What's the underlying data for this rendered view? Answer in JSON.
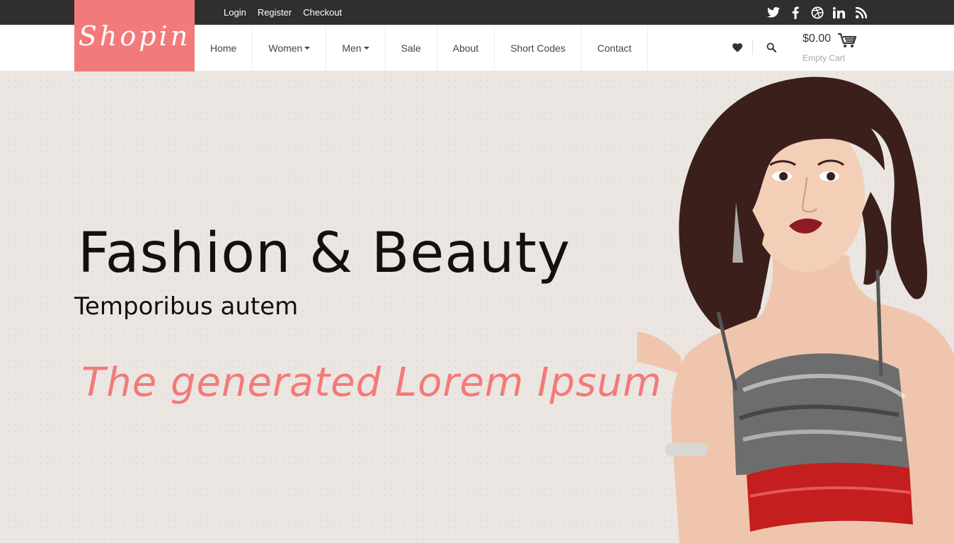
{
  "topbar": {
    "links": [
      "Login",
      "Register",
      "Checkout"
    ],
    "social_icons": [
      "twitter-icon",
      "facebook-icon",
      "dribbble-icon",
      "linkedin-icon",
      "rss-icon"
    ]
  },
  "logo": {
    "text": "Shopin"
  },
  "nav": {
    "items": [
      {
        "label": "Home",
        "dropdown": false
      },
      {
        "label": "Women",
        "dropdown": true
      },
      {
        "label": "Men",
        "dropdown": true
      },
      {
        "label": "Sale",
        "dropdown": false
      },
      {
        "label": "About",
        "dropdown": false
      },
      {
        "label": "Short Codes",
        "dropdown": false
      },
      {
        "label": "Contact",
        "dropdown": false
      }
    ]
  },
  "header_actions": {
    "wishlist_icon": "heart-icon",
    "search_icon": "search-icon",
    "cart_icon": "cart-icon",
    "cart_total": "$0.00",
    "cart_status": "Empty Cart"
  },
  "hero": {
    "title": "Fashion & Beauty",
    "subtitle": "Temporibus autem",
    "tagline": "The generated Lorem Ipsum"
  },
  "colors": {
    "accent": "#f37a7a",
    "topbar": "#2f2f2f",
    "hero_bg": "#ebe6e1"
  }
}
